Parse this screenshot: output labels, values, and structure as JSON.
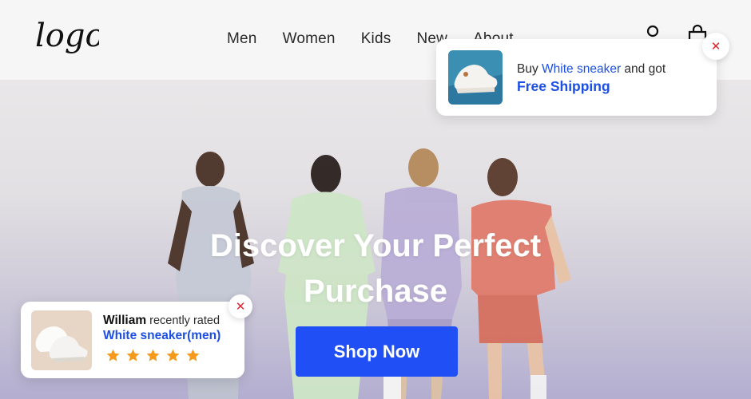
{
  "header": {
    "logo_text": "logo",
    "nav": [
      "Men",
      "Women",
      "Kids",
      "New",
      "About"
    ],
    "icons": {
      "account": "user-icon",
      "cart": "shopping-bag-icon"
    }
  },
  "hero": {
    "title_line1": "Discover Your Perfect",
    "title_line2": "Purchase",
    "cta_label": "Shop Now"
  },
  "promo_toast": {
    "prefix": "Buy",
    "product": "White sneaker",
    "suffix": "and got",
    "offer": "Free Shipping",
    "close_icon": "close-icon"
  },
  "rating_toast": {
    "user": "William",
    "action": "recently rated",
    "product": "White sneaker(men)",
    "rating": 5,
    "rating_max": 5,
    "close_icon": "close-icon"
  },
  "colors": {
    "accent": "#1f4ff5",
    "link": "#1c4fe3",
    "close": "#e0242c",
    "star": "#f59a1b"
  }
}
